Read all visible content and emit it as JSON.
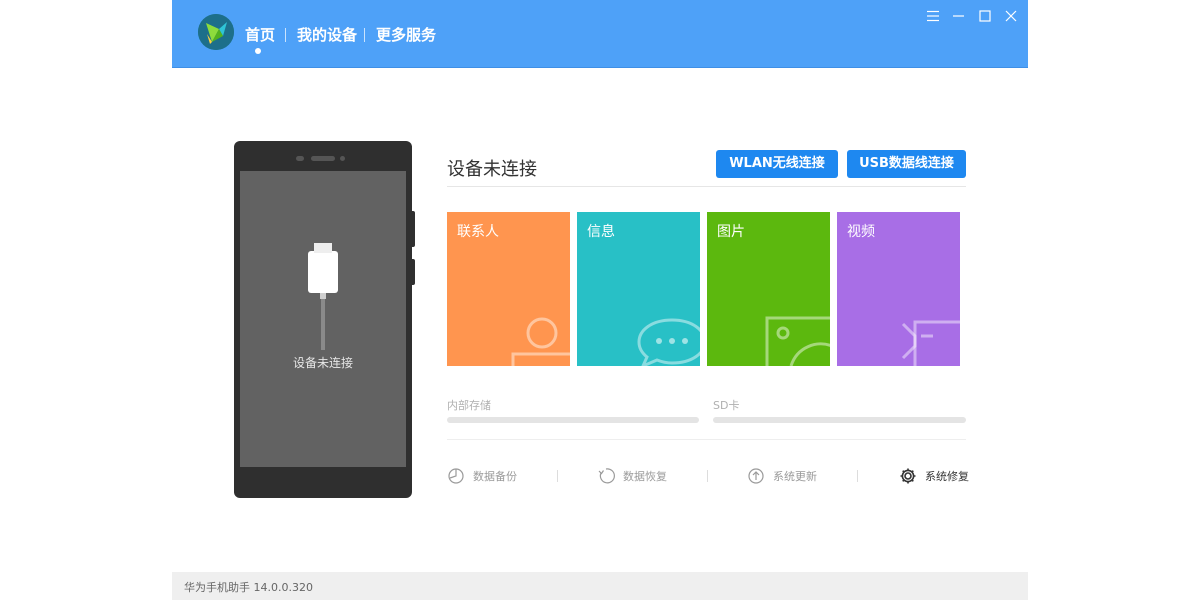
{
  "header": {
    "nav": [
      {
        "label": "首页",
        "active": true
      },
      {
        "label": "我的设备",
        "active": false
      },
      {
        "label": "更多服务",
        "active": false
      }
    ],
    "window_controls": [
      "menu-icon",
      "minimize-icon",
      "maximize-icon",
      "close-icon"
    ],
    "bg_color": "#4ea1f8"
  },
  "phone": {
    "status": "设备未连接",
    "illustration": "usb-cable-icon"
  },
  "connection": {
    "title": "设备未连接",
    "wlan_button": "WLAN无线连接",
    "usb_button": "USB数据线连接"
  },
  "tiles": [
    {
      "label": "联系人",
      "color": "#ff954f",
      "icon": "contact-person-icon"
    },
    {
      "label": "信息",
      "color": "#28c0c6",
      "icon": "message-bubble-icon"
    },
    {
      "label": "图片",
      "color": "#5cb80e",
      "icon": "picture-icon"
    },
    {
      "label": "视频",
      "color": "#a86ee6",
      "icon": "video-camera-icon"
    }
  ],
  "storage": {
    "internal_label": "内部存储",
    "sd_label": "SD卡"
  },
  "actions": [
    {
      "label": "数据备份",
      "icon": "backup-icon"
    },
    {
      "label": "数据恢复",
      "icon": "restore-icon"
    },
    {
      "label": "系统更新",
      "icon": "update-icon"
    },
    {
      "label": "系统修复",
      "icon": "gear-icon"
    }
  ],
  "footer": {
    "version_text": "华为手机助手 14.0.0.320"
  }
}
